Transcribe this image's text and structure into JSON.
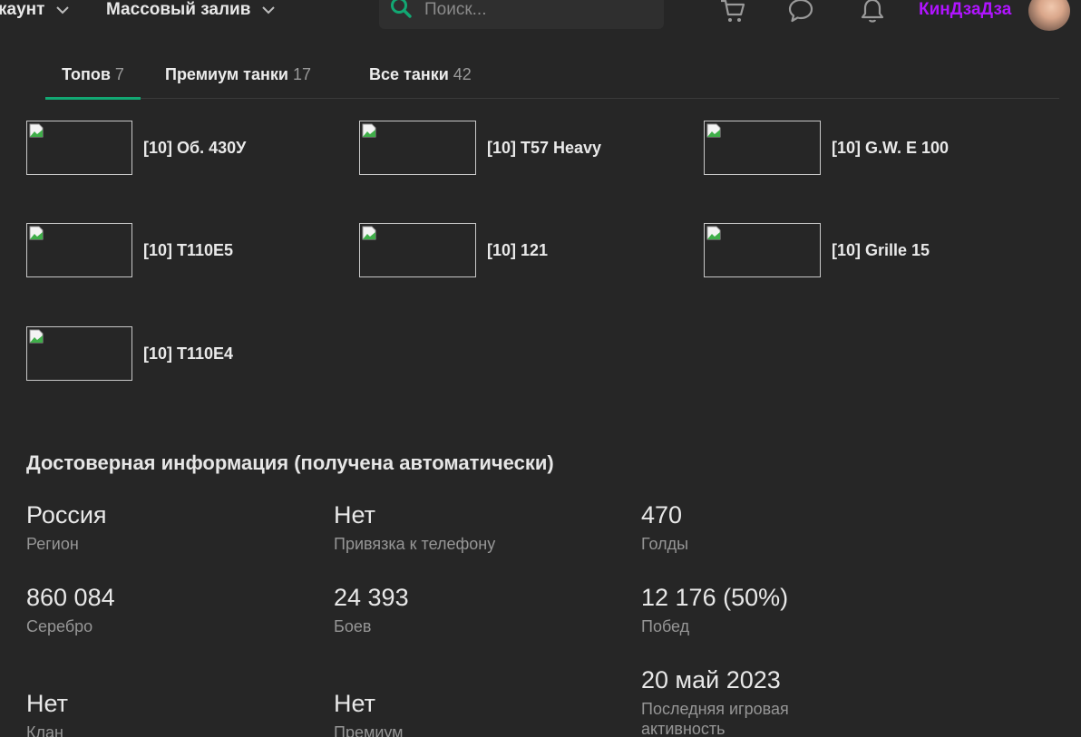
{
  "nav": {
    "account_label": "каунт",
    "mass_label": "Массовый залив",
    "search_placeholder": "Поиск...",
    "username": "КинДзаДза",
    "accent_color": "#12a873",
    "username_color": "#b014ff"
  },
  "icons": {
    "search": "search-icon",
    "cart": "cart-icon",
    "chat": "chat-bubble-icon",
    "bell": "bell-icon",
    "chevron": "chevron-down-icon"
  },
  "tabs": [
    {
      "label": "Топов",
      "count": "7",
      "active": true
    },
    {
      "label": "Премиум танки",
      "count": "17",
      "active": false
    },
    {
      "label": "Все танки",
      "count": "42",
      "active": false
    }
  ],
  "tanks": [
    {
      "name": "[10] Об. 430У"
    },
    {
      "name": "[10] T57 Heavy"
    },
    {
      "name": "[10] G.W. E 100"
    },
    {
      "name": "[10] T110E5"
    },
    {
      "name": "[10] 121"
    },
    {
      "name": "[10] Grille 15"
    },
    {
      "name": "[10] T110E4"
    }
  ],
  "info": {
    "title": "Достоверная информация (получена автоматически)",
    "cells": [
      {
        "value": "Россия",
        "label": "Регион"
      },
      {
        "value": "Нет",
        "label": "Привязка к телефону"
      },
      {
        "value": "470",
        "label": "Голды"
      },
      {
        "value": "860 084",
        "label": "Серебро"
      },
      {
        "value": "24 393",
        "label": "Боев"
      },
      {
        "value": "12 176 (50%)",
        "label": "Побед"
      },
      {
        "value": "Нет",
        "label": "Клан"
      },
      {
        "value": "Нет",
        "label": "Премиум"
      },
      {
        "value": "20 май 2023",
        "label": "Последняя игровая активность"
      }
    ]
  }
}
